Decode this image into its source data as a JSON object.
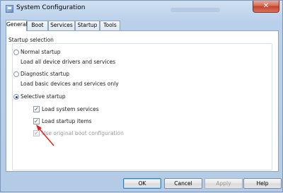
{
  "window": {
    "title": "System Configuration",
    "close_glyph": "✕"
  },
  "tabs": [
    "General",
    "Boot",
    "Services",
    "Startup",
    "Tools"
  ],
  "active_tab": "General",
  "startup_selection": {
    "legend": "Startup selection",
    "normal": {
      "label": "Normal startup",
      "description": "Load all device drivers and services",
      "checked": false
    },
    "diagnostic": {
      "label": "Diagnostic startup",
      "description": "Load basic devices and services only",
      "checked": false
    },
    "selective": {
      "label": "Selective startup",
      "checked": true,
      "options": {
        "load_system_services": {
          "label": "Load system services",
          "checked": true
        },
        "load_startup_items": {
          "label": "Load startup items",
          "checked": true
        },
        "use_original_boot_config": {
          "label": "Use original boot configuration",
          "checked": true,
          "disabled": true
        }
      }
    }
  },
  "buttons": {
    "ok": "OK",
    "cancel": "Cancel",
    "apply": "Apply",
    "help": "Help"
  },
  "annotation": {
    "arrow_color": "#e02020"
  }
}
